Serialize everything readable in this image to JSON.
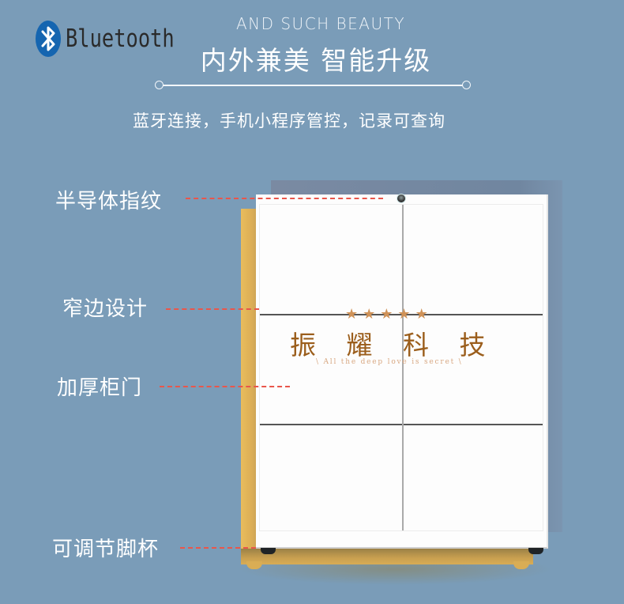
{
  "logo": {
    "icon": "bluetooth-icon",
    "text": "Bluetooth",
    "color": "#1565b0"
  },
  "header": {
    "subtitle_en": "AND SUCH BEAUTY",
    "title_cn": "内外兼美 智能升级",
    "description": "蓝牙连接，手机小程序管控，记录可查询"
  },
  "features": [
    {
      "label": "半导体指纹",
      "target": "fingerprint-sensor"
    },
    {
      "label": "窄边设计",
      "target": "narrow-frame"
    },
    {
      "label": "加厚柜门",
      "target": "thick-door"
    },
    {
      "label": "可调节脚杯",
      "target": "adjustable-feet"
    }
  ],
  "brand": {
    "stars": [
      "★",
      "★",
      "★",
      "★",
      "★"
    ],
    "name": "振 耀 科 技",
    "slogan": "\\ All the deep love is secret \\",
    "color": "#9b5e1c"
  },
  "colors": {
    "background": "#7a9cb8",
    "leader_line": "#e9564b",
    "frame": "#e2b55a",
    "star": "#cf9258"
  }
}
